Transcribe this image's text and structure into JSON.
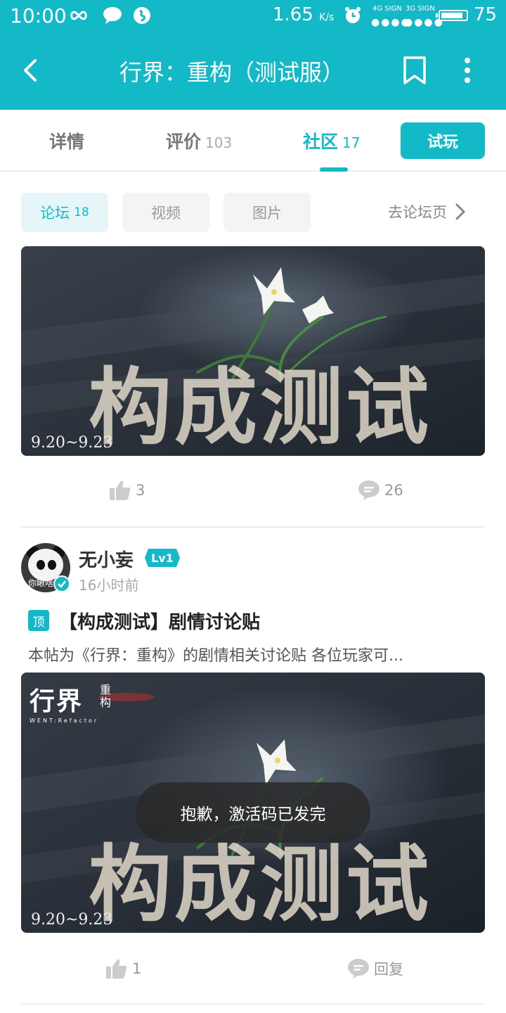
{
  "status_bar": {
    "time": "10:00",
    "speed": "1.65",
    "speed_unit": "K/s",
    "sig1_label": "4G SIGN",
    "sig2_label": "3G SIGN",
    "battery": "75"
  },
  "header": {
    "title": "行界：重构（测试服）"
  },
  "tabs": [
    {
      "label": "详情",
      "count": ""
    },
    {
      "label": "评价",
      "count": "103"
    },
    {
      "label": "社区",
      "count": "17"
    }
  ],
  "play_button": "试玩",
  "filters": [
    {
      "label": "论坛",
      "count": "18"
    },
    {
      "label": "视频",
      "count": ""
    },
    {
      "label": "图片",
      "count": ""
    }
  ],
  "goto_forum": "去论坛页",
  "post1": {
    "image_big_text": "构成测试",
    "image_date": "9.20~9.23",
    "likes": "3",
    "comments": "26"
  },
  "post2": {
    "username": "无小妄",
    "level": "Lv1",
    "avatar_caption": "你瞅啥",
    "time": "16小时前",
    "pin_label": "顶",
    "title": "【构成测试】剧情讨论贴",
    "excerpt": "本帖为《行界：重构》的剧情相关讨论贴 各位玩家可...",
    "image_logo": "行界",
    "image_logo_side": "重构",
    "image_logo_sub": "WENT:Refactor",
    "image_big_text": "构成测试",
    "image_date": "9.20~9.23",
    "likes": "1",
    "reply_label": "回复"
  },
  "toast": "抱歉，激活码已发完",
  "colors": {
    "accent": "#14b9c8",
    "text_primary": "#333333",
    "text_secondary": "#999999"
  }
}
